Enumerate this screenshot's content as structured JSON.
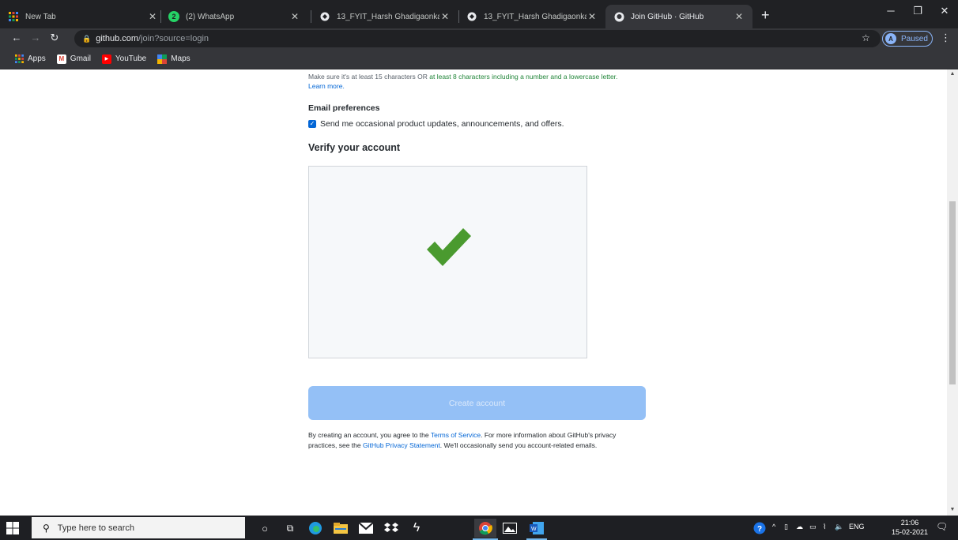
{
  "browser": {
    "tabs": [
      {
        "title": "New Tab",
        "favicon": "apps-grid-icon",
        "active": false
      },
      {
        "title": "(2) WhatsApp",
        "favicon": "whatsapp-icon",
        "badge": "2",
        "active": false
      },
      {
        "title": "13_FYIT_Harsh Ghadigaonkar_IT-",
        "favicon": "globe-icon",
        "active": false
      },
      {
        "title": "13_FYIT_Harsh Ghadigaonkar_IT-",
        "favicon": "globe-icon",
        "active": false
      },
      {
        "title": "Join GitHub · GitHub",
        "favicon": "github-icon",
        "active": true
      }
    ],
    "url_host": "github.com",
    "url_path": "/join?source=login",
    "profile_initial": "A",
    "profile_status": "Paused",
    "bookmarks": [
      {
        "label": "Apps",
        "icon": "apps-grid-icon"
      },
      {
        "label": "Gmail",
        "icon": "gmail-icon"
      },
      {
        "label": "YouTube",
        "icon": "youtube-icon"
      },
      {
        "label": "Maps",
        "icon": "maps-icon"
      }
    ]
  },
  "signup": {
    "password_hint_prefix": "Make sure it's at least 15 characters OR ",
    "password_hint_ok": "at least 8 characters including a number and a lowercase letter.",
    "learn_more": "Learn more.",
    "email_pref_heading": "Email preferences",
    "email_pref_checkbox": "Send me occasional product updates, announcements, and offers.",
    "email_pref_checked": true,
    "verify_heading": "Verify your account",
    "create_button": "Create account",
    "terms_part1": "By creating an account, you agree to the ",
    "terms_link": "Terms of Service",
    "terms_part2": ". For more information about GitHub's privacy practices, see the ",
    "privacy_link": "GitHub Privacy Statement",
    "terms_part3": ". We'll occasionally send you account-related emails."
  },
  "taskbar": {
    "search_placeholder": "Type here to search",
    "language": "ENG",
    "time": "21:06",
    "date": "15-02-2021",
    "notification_count": "1"
  },
  "colors": {
    "check_green": "#4a9a2f",
    "link_blue": "#0366d6",
    "button_disabled": "#94c0f6",
    "hint_green": "#22863a"
  }
}
